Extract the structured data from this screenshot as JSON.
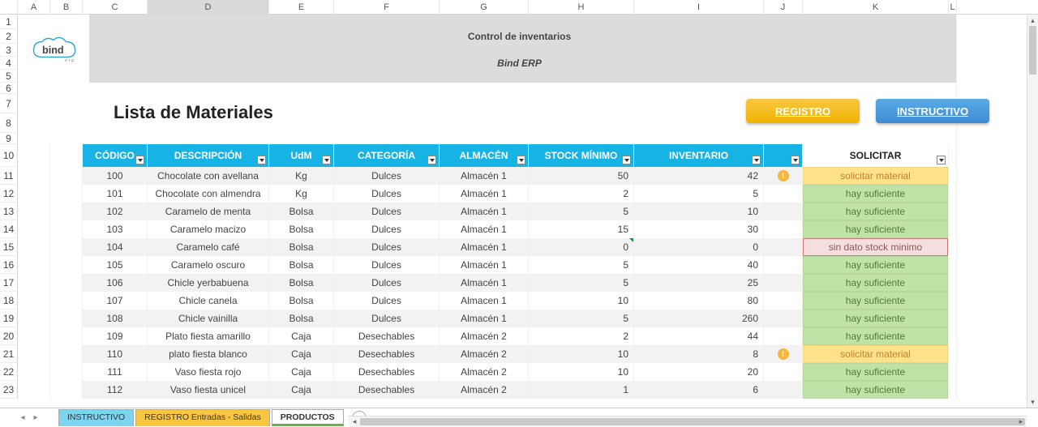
{
  "columns": [
    "",
    "A",
    "B",
    "C",
    "D",
    "E",
    "F",
    "G",
    "H",
    "I",
    "J",
    "K",
    "L"
  ],
  "selected_column_index": 4,
  "banner": {
    "title": "Control de inventarios",
    "subtitle": "Bind ERP"
  },
  "section_title": "Lista de Materiales",
  "buttons": {
    "registro": "REGISTRO",
    "instructivo": "INSTRUCTIVO"
  },
  "headers": {
    "codigo": "CÓDIGO",
    "descripcion": "DESCRIPCIÓN",
    "udm": "UdM",
    "categoria": "CATEGORÍA",
    "almacen": "ALMACÉN",
    "stock_minimo": "STOCK MÍNIMO",
    "inventario": "INVENTARIO",
    "solicitar": "SOLICITAR"
  },
  "status_labels": {
    "solicitar": "solicitar material",
    "suficiente": "hay suficiente",
    "sindato": "sin dato stock minimo"
  },
  "row_numbers_header_block": [
    1,
    2,
    3,
    4,
    5,
    6,
    7,
    8,
    9
  ],
  "row_numbers_table_header": 10,
  "chart_data": {
    "type": "table",
    "title": "Lista de Materiales",
    "columns": [
      "CÓDIGO",
      "DESCRIPCIÓN",
      "UdM",
      "CATEGORÍA",
      "ALMACÉN",
      "STOCK MÍNIMO",
      "INVENTARIO",
      "SOLICITAR"
    ],
    "rows": [
      {
        "row_num": 11,
        "codigo": "100",
        "descripcion": "Chocolate con avellana",
        "udm": "Kg",
        "categoria": "Dulces",
        "almacen": "Almacén 1",
        "stock_minimo": 50,
        "inventario": 42,
        "warn": true,
        "status": "solicitar"
      },
      {
        "row_num": 12,
        "codigo": "101",
        "descripcion": "Chocolate con almendra",
        "udm": "Kg",
        "categoria": "Dulces",
        "almacen": "Almacén 1",
        "stock_minimo": 2,
        "inventario": 5,
        "warn": false,
        "status": "suficiente"
      },
      {
        "row_num": 13,
        "codigo": "102",
        "descripcion": "Caramelo de menta",
        "udm": "Bolsa",
        "categoria": "Dulces",
        "almacen": "Almacén 1",
        "stock_minimo": 5,
        "inventario": 10,
        "warn": false,
        "status": "suficiente"
      },
      {
        "row_num": 14,
        "codigo": "103",
        "descripcion": "Caramelo macizo",
        "udm": "Bolsa",
        "categoria": "Dulces",
        "almacen": "Almacén 1",
        "stock_minimo": 15,
        "inventario": 30,
        "warn": false,
        "status": "suficiente"
      },
      {
        "row_num": 15,
        "codigo": "104",
        "descripcion": "Caramelo café",
        "udm": "Bolsa",
        "categoria": "Dulces",
        "almacen": "Almacén 1",
        "stock_minimo": 0,
        "inventario": 0,
        "warn": false,
        "status": "sindato",
        "green_mark": true
      },
      {
        "row_num": 16,
        "codigo": "105",
        "descripcion": "Caramelo oscuro",
        "udm": "Bolsa",
        "categoria": "Dulces",
        "almacen": "Almacén 1",
        "stock_minimo": 5,
        "inventario": 40,
        "warn": false,
        "status": "suficiente"
      },
      {
        "row_num": 17,
        "codigo": "106",
        "descripcion": "Chicle yerbabuena",
        "udm": "Bolsa",
        "categoria": "Dulces",
        "almacen": "Almacén 1",
        "stock_minimo": 5,
        "inventario": 25,
        "warn": false,
        "status": "suficiente"
      },
      {
        "row_num": 18,
        "codigo": "107",
        "descripcion": "Chicle canela",
        "udm": "Bolsa",
        "categoria": "Dulces",
        "almacen": "Almacen 1",
        "stock_minimo": 10,
        "inventario": 80,
        "warn": false,
        "status": "suficiente"
      },
      {
        "row_num": 19,
        "codigo": "108",
        "descripcion": "Chicle vainilla",
        "udm": "Bolsa",
        "categoria": "Dulces",
        "almacen": "Almacén 1",
        "stock_minimo": 5,
        "inventario": 260,
        "warn": false,
        "status": "suficiente"
      },
      {
        "row_num": 20,
        "codigo": "109",
        "descripcion": "Plato fiesta amarillo",
        "udm": "Caja",
        "categoria": "Desechables",
        "almacen": "Almacén 2",
        "stock_minimo": 2,
        "inventario": 44,
        "warn": false,
        "status": "suficiente"
      },
      {
        "row_num": 21,
        "codigo": "110",
        "descripcion": "plato fiesta blanco",
        "udm": "Caja",
        "categoria": "Desechables",
        "almacen": "Almacén 2",
        "stock_minimo": 10,
        "inventario": 8,
        "warn": true,
        "status": "solicitar"
      },
      {
        "row_num": 22,
        "codigo": "111",
        "descripcion": "Vaso fiesta rojo",
        "udm": "Caja",
        "categoria": "Desechables",
        "almacen": "Almacén 2",
        "stock_minimo": 10,
        "inventario": 20,
        "warn": false,
        "status": "suficiente"
      },
      {
        "row_num": 23,
        "codigo": "112",
        "descripcion": "Vaso fiesta unicel",
        "udm": "Caja",
        "categoria": "Desechables",
        "almacen": "Almacén 2",
        "stock_minimo": 1,
        "inventario": 6,
        "warn": false,
        "status": "suficiente"
      }
    ]
  },
  "tabs": [
    {
      "label": "INSTRUCTIVO",
      "style": "cyan",
      "active": false
    },
    {
      "label": "REGISTRO Entradas - Salidas",
      "style": "yellow",
      "active": false
    },
    {
      "label": "PRODUCTOS",
      "style": "active",
      "active": true
    }
  ]
}
